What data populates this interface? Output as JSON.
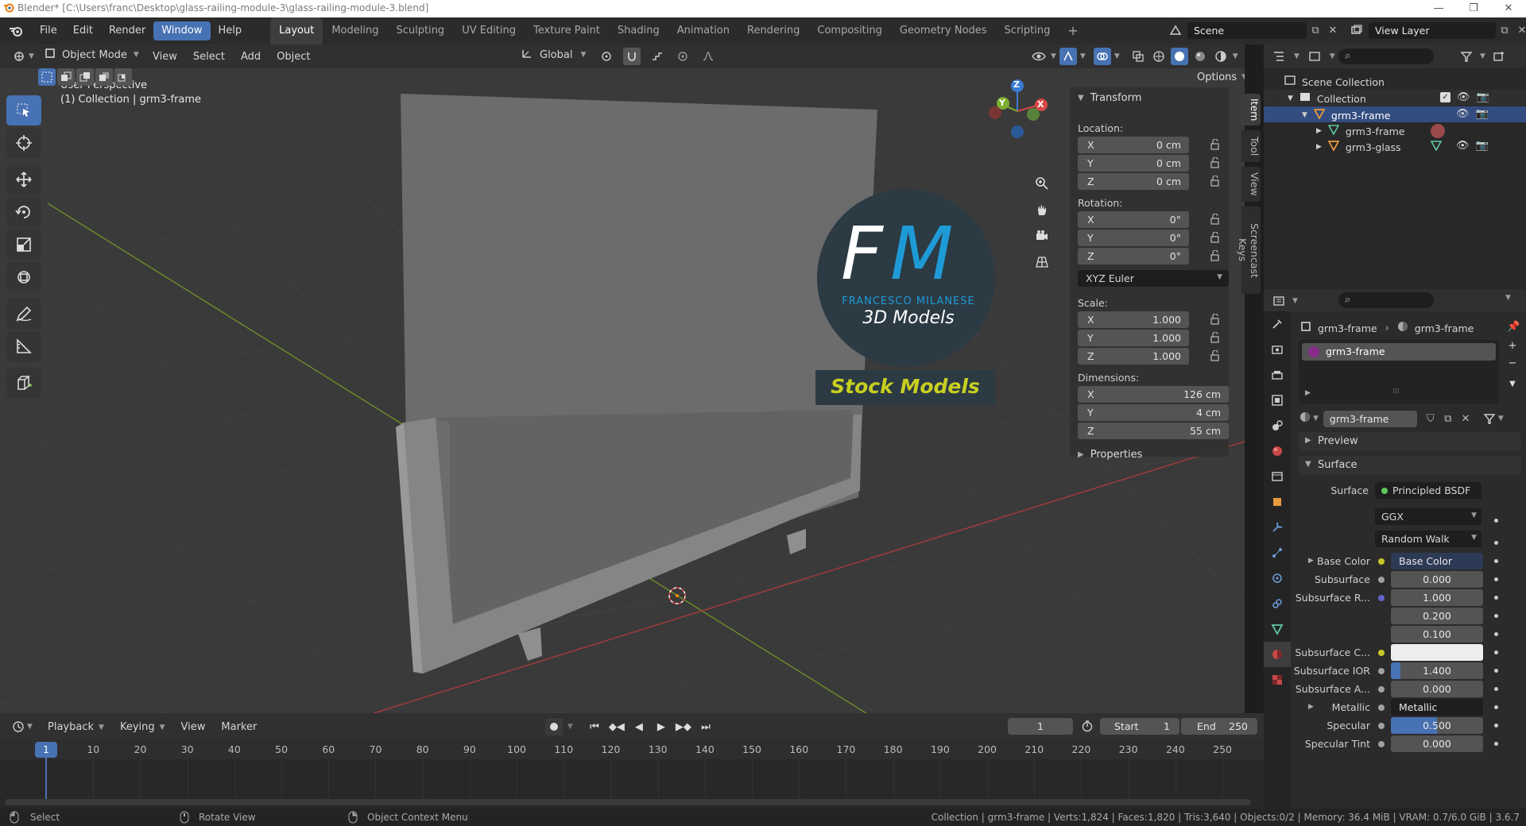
{
  "window": {
    "title": "Blender* [C:\\Users\\franc\\Desktop\\glass-railing-module-3\\glass-railing-module-3.blend]",
    "minimize": "—",
    "maximize": "❐",
    "close": "✕"
  },
  "menu": [
    "File",
    "Edit",
    "Render",
    "Window",
    "Help"
  ],
  "menu_active": "Window",
  "workspaces": [
    "Layout",
    "Modeling",
    "Sculpting",
    "UV Editing",
    "Texture Paint",
    "Shading",
    "Animation",
    "Rendering",
    "Compositing",
    "Geometry Nodes",
    "Scripting"
  ],
  "workspace_add": "+",
  "scene": {
    "name": "Scene",
    "view_layer": "View Layer"
  },
  "header3d": {
    "mode": "Object Mode",
    "menus": [
      "View",
      "Select",
      "Add",
      "Object"
    ],
    "orientation": "Global",
    "options": "Options"
  },
  "viewport": {
    "perspective": "User Perspective",
    "collection_info": "(1) Collection | grm3-frame",
    "gizmo_axes": [
      "Z",
      "Y",
      "X"
    ]
  },
  "watermark": {
    "letters_f": "F",
    "letters_m": "M",
    "name": "FRANCESCO MILANESE",
    "sub": "3D Models",
    "banner": "Stock Models"
  },
  "npanel": {
    "section": "Transform",
    "location_label": "Location:",
    "location": [
      {
        "ax": "X",
        "val": "0 cm"
      },
      {
        "ax": "Y",
        "val": "0 cm"
      },
      {
        "ax": "Z",
        "val": "0 cm"
      }
    ],
    "rotation_label": "Rotation:",
    "rotation": [
      {
        "ax": "X",
        "val": "0°"
      },
      {
        "ax": "Y",
        "val": "0°"
      },
      {
        "ax": "Z",
        "val": "0°"
      }
    ],
    "rotation_mode": "XYZ Euler",
    "scale_label": "Scale:",
    "scale": [
      {
        "ax": "X",
        "val": "1.000"
      },
      {
        "ax": "Y",
        "val": "1.000"
      },
      {
        "ax": "Z",
        "val": "1.000"
      }
    ],
    "dimensions_label": "Dimensions:",
    "dimensions": [
      {
        "ax": "X",
        "val": "126 cm"
      },
      {
        "ax": "Y",
        "val": "4 cm"
      },
      {
        "ax": "Z",
        "val": "55 cm"
      }
    ],
    "properties": "Properties",
    "tabs": [
      "Item",
      "Tool",
      "View",
      "Screencast Keys"
    ]
  },
  "outliner": {
    "root": "Scene Collection",
    "collection": "Collection",
    "items": [
      {
        "name": "grm3-frame",
        "level": 2
      },
      {
        "name": "grm3-frame",
        "level": 3
      },
      {
        "name": "grm3-glass",
        "level": 3
      }
    ]
  },
  "props": {
    "breadcrumb_a": "grm3-frame",
    "breadcrumb_b": "grm3-frame",
    "slot": "grm3-frame",
    "material": "grm3-frame",
    "preview": "Preview",
    "surface_section": "Surface",
    "surface_label": "Surface",
    "surface_value": "Principled BSDF",
    "distribution": "GGX",
    "subsurface_method": "Random Walk",
    "rows": [
      {
        "label": "Base Color",
        "value": "Base Color",
        "kind": "link",
        "dot": "#c7c729"
      },
      {
        "label": "Subsurface",
        "value": "0.000",
        "kind": "num",
        "dot": "#a1a1a1"
      },
      {
        "label": "Subsurface R...",
        "value": "1.000",
        "kind": "num",
        "dot": "#6363c7"
      },
      {
        "label": "",
        "value": "0.200",
        "kind": "num",
        "dot": ""
      },
      {
        "label": "",
        "value": "0.100",
        "kind": "num",
        "dot": ""
      },
      {
        "label": "Subsurface C...",
        "value": "",
        "kind": "color",
        "dot": "#c7c729"
      },
      {
        "label": "Subsurface IOR",
        "value": "1.400",
        "kind": "slider",
        "dot": "#a1a1a1"
      },
      {
        "label": "Subsurface A...",
        "value": "0.000",
        "kind": "num",
        "dot": "#a1a1a1"
      },
      {
        "label": "Metallic",
        "value": "Metallic",
        "kind": "link",
        "dot": "#a1a1a1"
      },
      {
        "label": "Specular",
        "value": "0.500",
        "kind": "slider",
        "dot": "#a1a1a1"
      },
      {
        "label": "Specular Tint",
        "value": "0.000",
        "kind": "num",
        "dot": "#a1a1a1"
      }
    ]
  },
  "timeline": {
    "menus": [
      "Playback",
      "Keying",
      "View",
      "Marker"
    ],
    "current_frame": "1",
    "start_label": "Start",
    "start": "1",
    "end_label": "End",
    "end": "250",
    "ticks": [
      "1",
      "10",
      "20",
      "30",
      "40",
      "50",
      "60",
      "70",
      "80",
      "90",
      "100",
      "110",
      "120",
      "130",
      "140",
      "150",
      "160",
      "170",
      "180",
      "190",
      "200",
      "210",
      "220",
      "230",
      "240",
      "250"
    ]
  },
  "status": {
    "select": "Select",
    "rotate": "Rotate View",
    "context": "Object Context Menu",
    "stats": "Collection | grm3-frame | Verts:1,824 | Faces:1,820 | Tris:3,640 | Objects:0/2 | Memory: 36.4 MiB | VRAM: 0.7/6.0 GiB | 3.6.7"
  },
  "colors": {
    "accent": "#4772b3",
    "fm_blue": "#1e9bd7",
    "banner_yellow": "#c8cf1f"
  }
}
